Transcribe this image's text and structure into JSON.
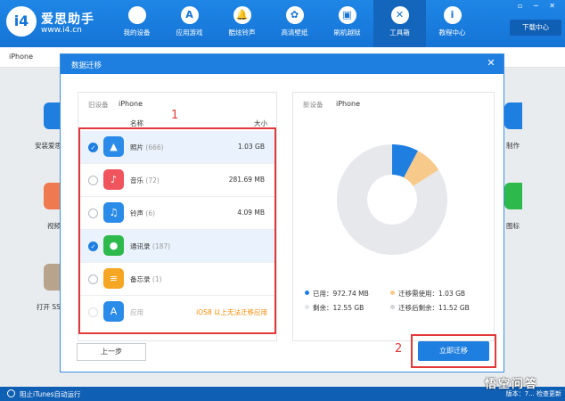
{
  "app": {
    "logo_glyph": "i4",
    "brand": "爱思助手",
    "url": "www.i4.cn",
    "window_controls": "▫ ─ ✕",
    "download_center": "下载中心"
  },
  "nav": [
    {
      "label": "我的设备",
      "icon": "apple-icon",
      "glyph": ""
    },
    {
      "label": "应用游戏",
      "icon": "appstore-icon",
      "glyph": "A"
    },
    {
      "label": "酷炫铃声",
      "icon": "bell-icon",
      "glyph": "🔔"
    },
    {
      "label": "高清壁纸",
      "icon": "flower-icon",
      "glyph": "✿"
    },
    {
      "label": "刷机越狱",
      "icon": "box-icon",
      "glyph": "▣"
    },
    {
      "label": "工具箱",
      "icon": "tools-icon",
      "glyph": "✕"
    },
    {
      "label": "教程中心",
      "icon": "info-icon",
      "glyph": "i"
    }
  ],
  "device_tab": "iPhone",
  "background_tiles": {
    "install": "安装爱思",
    "video": "视频",
    "open_ssh": "打开 SS",
    "make": "制作",
    "icon": "图标"
  },
  "dialog": {
    "title": "数据迁移",
    "close_glyph": "✕",
    "old_device_label": "旧设备",
    "old_device_value": "iPhone",
    "col_name": "名称",
    "col_size": "大小",
    "new_device_label": "新设备",
    "new_device_value": "iPhone",
    "prev_button": "上一步",
    "migrate_button": "立即迁移"
  },
  "items": [
    {
      "name": "照片",
      "count": "(666)",
      "size": "1.03 GB",
      "checked": true,
      "color": "#2b8be8",
      "icon": "photo-icon",
      "glyph": "▲"
    },
    {
      "name": "音乐",
      "count": "(72)",
      "size": "281.69 MB",
      "checked": false,
      "color": "#f0555d",
      "icon": "music-icon",
      "glyph": "♪"
    },
    {
      "name": "铃声",
      "count": "(6)",
      "size": "4.09 MB",
      "checked": false,
      "color": "#2b8be8",
      "icon": "bell-icon",
      "glyph": "♫"
    },
    {
      "name": "通讯录",
      "count": "(187)",
      "size": "",
      "checked": true,
      "color": "#2eb94d",
      "icon": "contacts-icon",
      "glyph": "●"
    },
    {
      "name": "备忘录",
      "count": "(1)",
      "size": "",
      "checked": false,
      "color": "#f5a623",
      "icon": "notes-icon",
      "glyph": "≡"
    },
    {
      "name": "应用",
      "count": "",
      "size": "iOS8 以上无法迁移应用",
      "checked": false,
      "disabled": true,
      "color": "#2b8be8",
      "icon": "appstore-icon",
      "glyph": "A"
    }
  ],
  "storage": {
    "used_label": "已用：972.74 MB",
    "needed_label": "迁移需使用：1.03 GB",
    "free_label": "剩余：12.55 GB",
    "after_label": "迁移后剩余：11.52 GB",
    "colors": {
      "used": "#1f7fe0",
      "needed": "#f7c98b",
      "free": "#e6e8eb",
      "after": "#d0d4d9"
    }
  },
  "chart_data": {
    "type": "pie",
    "series": [
      {
        "name": "已用",
        "value": 0.97274
      },
      {
        "name": "迁移需使用",
        "value": 1.03
      },
      {
        "name": "剩余",
        "value": 10.55
      }
    ]
  },
  "annotations": {
    "box1": "1",
    "box2": "2"
  },
  "status": {
    "itunes_text": "阻止iTunes自动运行",
    "version": "版本：7...",
    "update": "检查更新"
  },
  "watermark": "悟空问答"
}
